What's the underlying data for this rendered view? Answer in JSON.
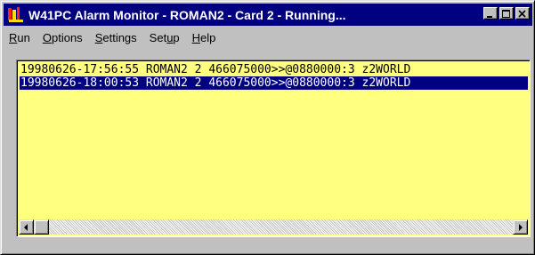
{
  "window": {
    "title": "W41PC Alarm Monitor - ROMAN2 - Card 2 - Running...",
    "icon": "alarm-app-icon",
    "controls": [
      "minimize",
      "maximize",
      "close"
    ]
  },
  "menu": {
    "run": "Run",
    "options": "Options",
    "settings": "Settings",
    "setup": "Setup",
    "help": "Help"
  },
  "log": {
    "background_color": "#ffff80",
    "selection_color": "#000080",
    "rows": [
      {
        "text": "19980626-17:56:55 ROMAN2 2 466075000>>@0880000:3 z2WORLD",
        "selected": false
      },
      {
        "text": "19980626-18:00:53 ROMAN2 2 466075000>>@0880000:3 z2WORLD",
        "selected": true
      }
    ]
  },
  "colors": {
    "titlebar": "#000080",
    "chrome": "#c0c0c0"
  }
}
